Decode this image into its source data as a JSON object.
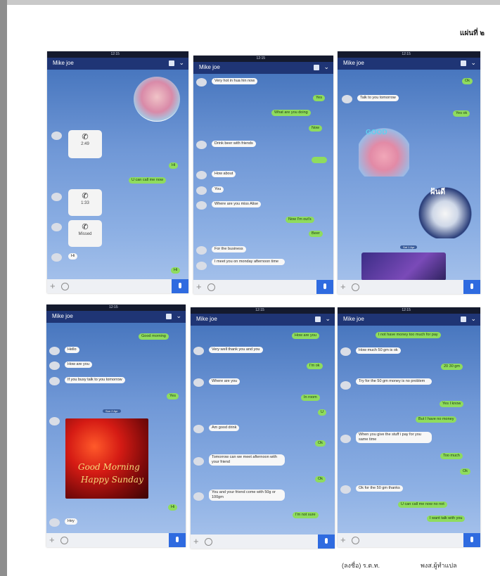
{
  "page": {
    "sheet_label": "แผ่นที่ ๒",
    "footer_left": "(ลงชื่อ) ร.ต.ท.",
    "footer_right": "พงส.ผู้ทำแปล"
  },
  "screens": [
    {
      "status_time": "12:15",
      "title": "Mike joe",
      "calls": [
        "2:49",
        "1:33",
        "Missed"
      ],
      "messages": [
        {
          "dir": "out",
          "text": "Hi"
        },
        {
          "dir": "out",
          "text": "U can call me now"
        },
        {
          "dir": "in",
          "text": "Hi"
        },
        {
          "dir": "out",
          "text": "Hi"
        }
      ]
    },
    {
      "status_time": "12:15",
      "title": "Mike joe",
      "messages": [
        {
          "dir": "in",
          "text": "Very hot in hua hin now"
        },
        {
          "dir": "out",
          "text": "Yes"
        },
        {
          "dir": "out",
          "text": "What are you doing"
        },
        {
          "dir": "out",
          "text": "Now"
        },
        {
          "dir": "in",
          "text": "Drink beer with friends"
        },
        {
          "dir": "in",
          "text": "How about"
        },
        {
          "dir": "in",
          "text": "You"
        },
        {
          "dir": "in",
          "text": "Where are you miss Alise"
        },
        {
          "dir": "out",
          "text": "Now I'm out's"
        },
        {
          "dir": "out",
          "text": "Beer"
        },
        {
          "dir": "in",
          "text": "For the business"
        },
        {
          "dir": "in",
          "text": "I meet you on monday afternoon time"
        }
      ]
    },
    {
      "status_time": "12:15",
      "title": "Mike joe",
      "messages": [
        {
          "dir": "out",
          "text": "Ok"
        },
        {
          "dir": "in",
          "text": "Talk to you tomorrow"
        },
        {
          "dir": "out",
          "text": "Yes ok"
        }
      ],
      "sticker_text_1": "GOOD",
      "sticker_text_2": "ฝันดี",
      "date_chip": "Sat 1 Apr"
    },
    {
      "status_time": "12:15",
      "title": "Mike joe",
      "messages": [
        {
          "dir": "out",
          "text": "Good morning"
        },
        {
          "dir": "in",
          "text": "Hello"
        },
        {
          "dir": "in",
          "text": "How are you"
        },
        {
          "dir": "in",
          "text": "If you busy talk to you tomorrow"
        },
        {
          "dir": "out",
          "text": "Yes"
        },
        {
          "dir": "out",
          "text": "Hi"
        },
        {
          "dir": "in",
          "text": "Hey"
        }
      ],
      "date_chip": "Sun 2 Apr",
      "greeting_line1": "Good Morning",
      "greeting_line2": "Happy Sunday"
    },
    {
      "status_time": "12:15",
      "title": "Mike joe",
      "messages": [
        {
          "dir": "out",
          "text": "How are you"
        },
        {
          "dir": "in",
          "text": "Very well thank you and you"
        },
        {
          "dir": "out",
          "text": "I'm ok"
        },
        {
          "dir": "in",
          "text": "Where are you"
        },
        {
          "dir": "out",
          "text": "In room"
        },
        {
          "dir": "out",
          "text": "U"
        },
        {
          "dir": "in",
          "text": "Am good drink"
        },
        {
          "dir": "out",
          "text": "Ok"
        },
        {
          "dir": "in",
          "text": "Tomorrow can we meet afternoon with your friend"
        },
        {
          "dir": "out",
          "text": "Ok"
        },
        {
          "dir": "in",
          "text": "You and your friend come with 50g or 100gm"
        },
        {
          "dir": "out",
          "text": "I'm not sure"
        }
      ]
    },
    {
      "status_time": "12:15",
      "title": "Mike joe",
      "messages": [
        {
          "dir": "out",
          "text": "I not have money too much for pay"
        },
        {
          "dir": "in",
          "text": "How much 50 gm is ok"
        },
        {
          "dir": "out",
          "text": "20 30 gm"
        },
        {
          "dir": "in",
          "text": "Try for the 50 gm money is no problem"
        },
        {
          "dir": "out",
          "text": "Yes I know"
        },
        {
          "dir": "out",
          "text": "But I have no money"
        },
        {
          "dir": "in",
          "text": "When you give the stuff i pay for you same time"
        },
        {
          "dir": "out",
          "text": "Too much"
        },
        {
          "dir": "out",
          "text": "Ok"
        },
        {
          "dir": "in",
          "text": "Ok for the 50 gm thanks"
        },
        {
          "dir": "out",
          "text": "U can call me now no not"
        },
        {
          "dir": "out",
          "text": "I want talk with you"
        }
      ]
    }
  ]
}
